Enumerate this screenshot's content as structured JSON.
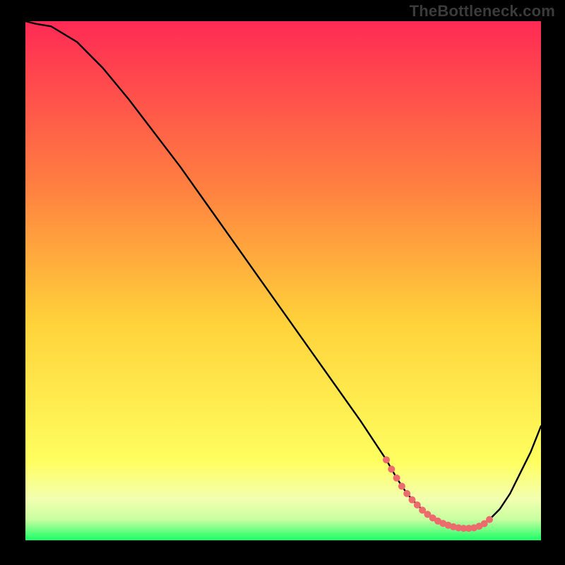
{
  "watermark": "TheBottleneck.com",
  "chart_data": {
    "type": "line",
    "title": "",
    "xlabel": "",
    "ylabel": "",
    "xlim": [
      0,
      100
    ],
    "ylim": [
      0,
      100
    ],
    "background_gradient": {
      "top": "#ff2a55",
      "mid_upper": "#ff8040",
      "mid": "#ffd23a",
      "mid_lower": "#ffff60",
      "bottom": "#19ff66"
    },
    "curve": {
      "x": [
        0,
        2,
        5,
        10,
        15,
        20,
        25,
        30,
        35,
        40,
        45,
        50,
        55,
        60,
        65,
        70,
        72,
        74,
        76,
        78,
        80,
        82,
        84,
        86,
        88,
        90,
        92,
        94,
        96,
        98,
        100
      ],
      "y": [
        100,
        99.5,
        99,
        96,
        91,
        85,
        78.5,
        72,
        65,
        58,
        51,
        44,
        37,
        30,
        23,
        15.5,
        12,
        9,
        6.8,
        5,
        3.7,
        2.9,
        2.4,
        2.3,
        2.7,
        4,
        6,
        9,
        13,
        17,
        22
      ]
    },
    "markers": {
      "x": [
        70,
        71,
        72,
        73,
        74,
        75,
        76,
        77,
        78,
        79,
        80,
        81,
        82,
        83,
        84,
        85,
        86,
        87,
        88,
        89,
        90
      ],
      "y": [
        15.5,
        13.7,
        12,
        10.4,
        9,
        7.8,
        6.8,
        5.8,
        5,
        4.3,
        3.7,
        3.25,
        2.9,
        2.6,
        2.4,
        2.3,
        2.3,
        2.4,
        2.7,
        3.2,
        4
      ],
      "color": "#ed6a6d",
      "radius": 5
    }
  }
}
